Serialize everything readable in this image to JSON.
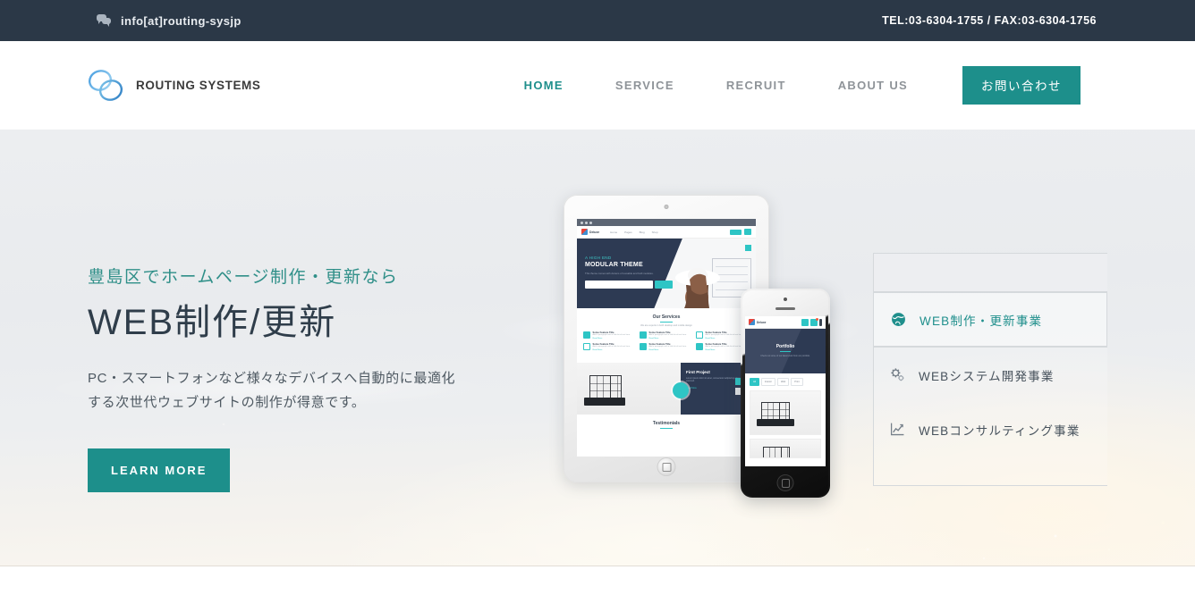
{
  "topbar": {
    "email": "info[at]routing-sysjp",
    "email_icon": "comments-icon",
    "phone": "TEL:03-6304-1755 / FAX:03-6304-1756"
  },
  "header": {
    "logo_icon": "routing-systems-rings-logo",
    "brand": "ROUTING SYSTEMS",
    "nav": [
      {
        "label": "HOME",
        "active": true
      },
      {
        "label": "SERVICE",
        "active": false
      },
      {
        "label": "RECRUIT",
        "active": false
      },
      {
        "label": "ABOUT US",
        "active": false
      }
    ],
    "contact_button": "お問い合わせ"
  },
  "hero": {
    "subtitle": "豊島区でホームページ制作・更新なら",
    "title": "WEB制作/更新",
    "description_line1": "PC・スマートフォンなど様々なデバイスへ自動的に最適化",
    "description_line2": "する次世代ウェブサイトの制作が得意です。",
    "cta_label": "LEARN MORE"
  },
  "services": [
    {
      "label": "WEB制作・更新事業",
      "icon": "globe-icon",
      "active": true
    },
    {
      "label": "WEBシステム開発事業",
      "icon": "cogs-icon",
      "active": false
    },
    {
      "label": "WEBコンサルティング事業",
      "icon": "line-chart-icon",
      "active": false
    }
  ],
  "mockup": {
    "tablet": {
      "brand": "Deluxe",
      "menu": [
        "Home",
        "Pages",
        "Blog",
        "Shop"
      ],
      "hero_kicker": "A HIGH END",
      "hero_title": "MODULAR THEME",
      "hero_lead": "This theme comes with dozens of reusable and built modules.",
      "hero_button": "Sign Up",
      "services_title": "Our Services",
      "services_sub": "We are experts in both desktop and mobile design",
      "service_cards": [
        {
          "title": "Some Feature Title",
          "text": "Add a paragraph with a little bit of text here."
        },
        {
          "title": "Some Feature Title",
          "text": "Add a paragraph with a little bit of text here."
        },
        {
          "title": "Some Feature Title",
          "text": "Add a paragraph with a little bit of text here."
        },
        {
          "title": "Some Feature Title",
          "text": "Add a paragraph with a little bit of text here."
        },
        {
          "title": "Some Feature Title",
          "text": "Add a paragraph with a little bit of text here."
        },
        {
          "title": "Some Feature Title",
          "text": "Add a paragraph with a little bit of text here."
        }
      ],
      "card_link": "Read More",
      "project_title": "First Project",
      "project_text": "Lorem ipsum dolor sit amet, consectetur adipiscing elit sed do eiusmod.",
      "project_link": "Read More",
      "testimonials_title": "Testimonials"
    },
    "phone": {
      "brand": "Deluxe",
      "hero_title": "Portfolio",
      "hero_lead": "Check out some of our latest work from our portfolio.",
      "filters": [
        "All",
        "Interior",
        "Web",
        "Print"
      ]
    }
  },
  "colors": {
    "topbar_bg": "#2b3847",
    "teal": "#1d8f8b",
    "teal_text": "#1f8f8c",
    "heading": "#2f3d4a",
    "body_text": "#4d5861",
    "nav_inactive": "#8f9499",
    "panel_border": "#d5d9dc"
  }
}
